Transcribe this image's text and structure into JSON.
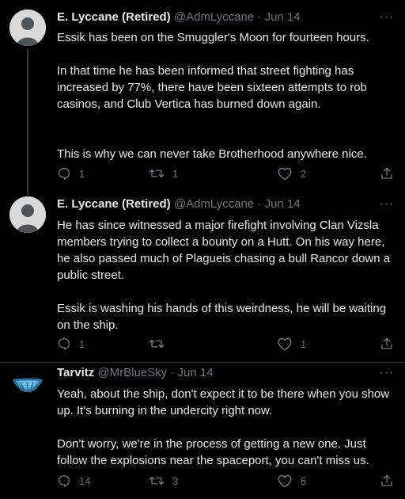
{
  "tweets": [
    {
      "name": "E. Lyccane (Retired)",
      "handle": "@AdmLyccane",
      "sep": "·",
      "date": "Jun 14",
      "paragraphs": [
        "Essik has been on the Smuggler's Moon for fourteen hours.",
        "In that time he has been informed that street fighting has increased by 77%, there have been sixteen attempts to rob casinos, and Club Vertica has burned down again.",
        "This is why we can never take Brotherhood anywhere nice."
      ],
      "replies": "1",
      "retweets": "1",
      "likes": "2"
    },
    {
      "name": "E. Lyccane (Retired)",
      "handle": "@AdmLyccane",
      "sep": "·",
      "date": "Jun 14",
      "paragraphs": [
        "He has since witnessed a major firefight involving Clan Vizsla members trying to collect a bounty on a Hutt. On his way here, he also passed much of Plagueis chasing a bull Rancor down a public street.",
        "Essik is washing his hands of this weirdness, he will be waiting on the ship."
      ],
      "replies": "1",
      "retweets": "",
      "likes": "1"
    },
    {
      "name": "Tarvitz",
      "handle": "@MrBlueSky",
      "sep": "·",
      "date": "Jun 14",
      "paragraphs": [
        "Yeah, about the ship, don't expect it to be there when you show up. It's burning in the undercity right now.",
        "Don't worry, we're in the process of getting a new one. Just follow the explosions near the spaceport, you can't miss us."
      ],
      "replies": "14",
      "retweets": "3",
      "likes": "6"
    }
  ],
  "more_label": "···",
  "icons": [
    "reply-icon",
    "retweet-icon",
    "like-icon",
    "share-icon",
    "more-icon",
    "default-avatar",
    "ship-avatar"
  ],
  "colors": {
    "background": "#000000",
    "text": "#e7e9ea",
    "muted": "#71767b",
    "divider": "#2f3336"
  }
}
